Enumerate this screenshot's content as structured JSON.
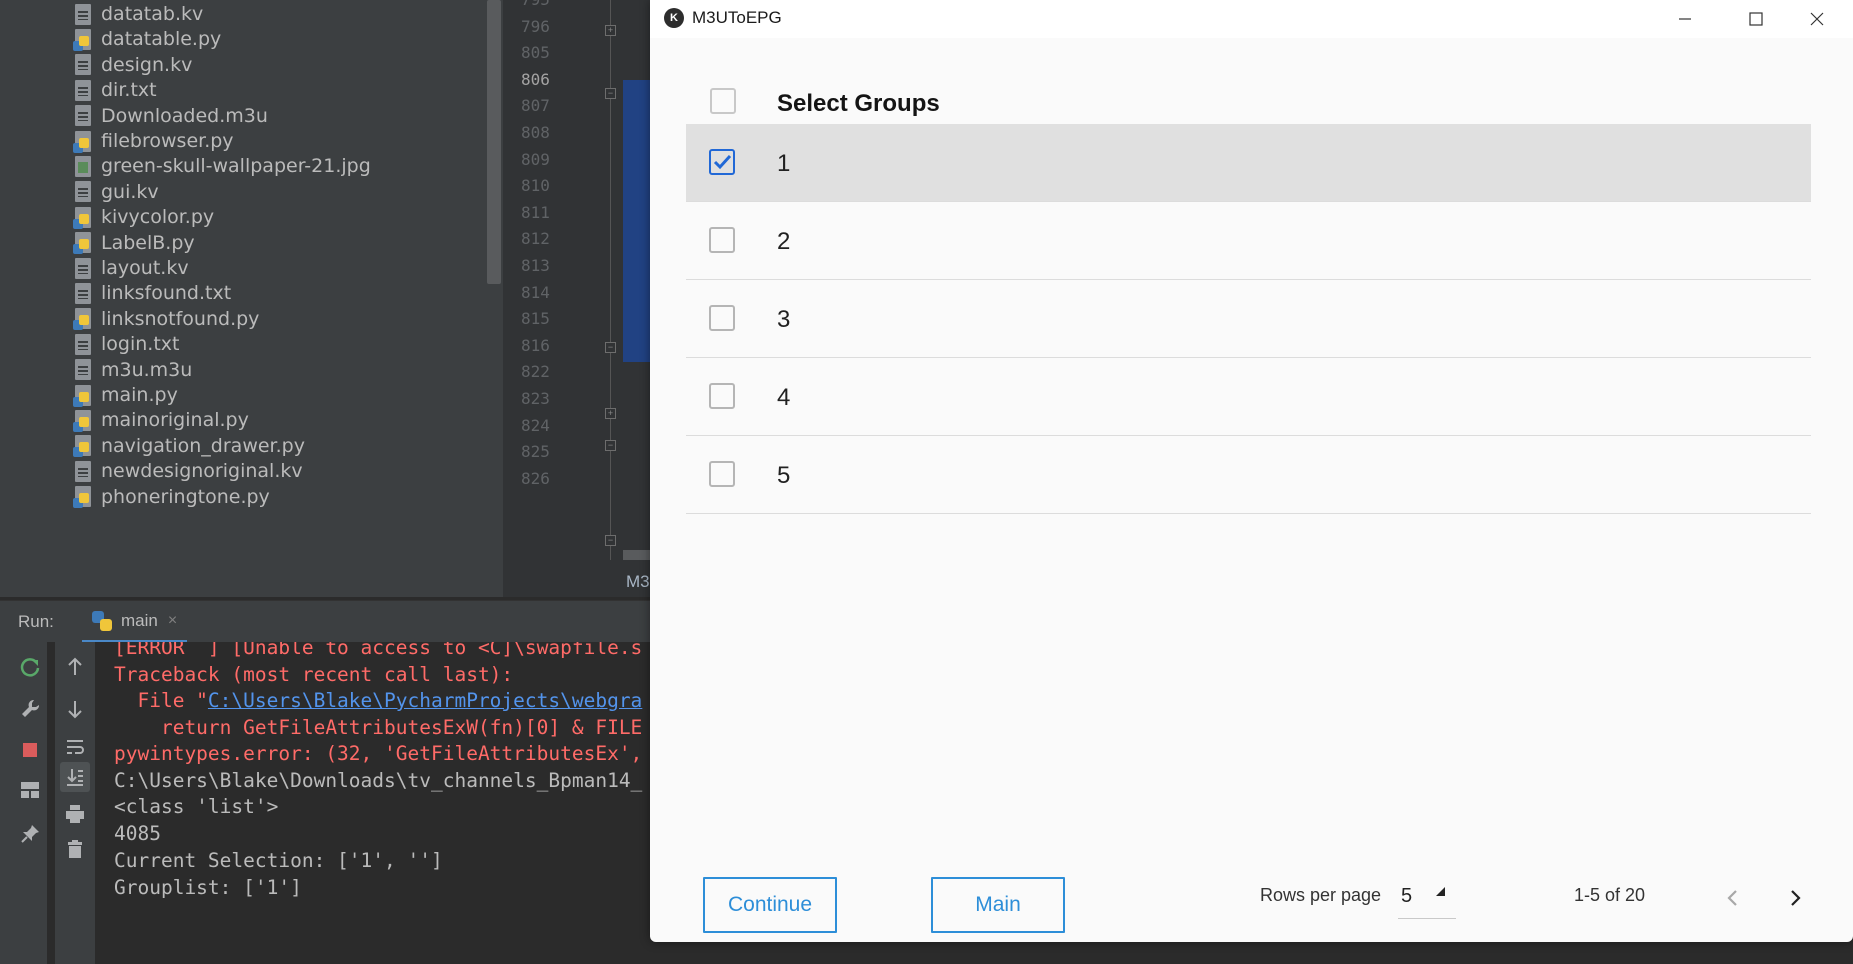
{
  "project_tree": {
    "files": [
      {
        "name": "datatab.kv",
        "type": "text"
      },
      {
        "name": "datatable.py",
        "type": "py"
      },
      {
        "name": "design.kv",
        "type": "text"
      },
      {
        "name": "dir.txt",
        "type": "text"
      },
      {
        "name": "Downloaded.m3u",
        "type": "text"
      },
      {
        "name": "filebrowser.py",
        "type": "py"
      },
      {
        "name": "green-skull-wallpaper-21.jpg",
        "type": "img"
      },
      {
        "name": "gui.kv",
        "type": "text"
      },
      {
        "name": "kivycolor.py",
        "type": "py"
      },
      {
        "name": "LabelB.py",
        "type": "py"
      },
      {
        "name": "layout.kv",
        "type": "text"
      },
      {
        "name": "linksfound.txt",
        "type": "text"
      },
      {
        "name": "linksnotfound.py",
        "type": "py"
      },
      {
        "name": "login.txt",
        "type": "text"
      },
      {
        "name": "m3u.m3u",
        "type": "text"
      },
      {
        "name": "main.py",
        "type": "py"
      },
      {
        "name": "mainoriginal.py",
        "type": "py"
      },
      {
        "name": "navigation_drawer.py",
        "type": "py"
      },
      {
        "name": "newdesignoriginal.kv",
        "type": "text"
      },
      {
        "name": "phoneringtone.py",
        "type": "py"
      }
    ]
  },
  "editor": {
    "line_numbers": [
      "795",
      "796",
      "805",
      "806",
      "807",
      "808",
      "809",
      "810",
      "811",
      "812",
      "813",
      "814",
      "815",
      "816",
      "822",
      "823",
      "824",
      "825",
      "826"
    ],
    "current_line": "806",
    "tab_fragment": "M3"
  },
  "run_panel": {
    "label": "Run:",
    "tab_name": "main",
    "tab_close": "×",
    "console": {
      "error_line_1": "[ERROR  ] [Unable to access to <C]\\swapfile.s",
      "traceback": "Traceback (most recent call last):",
      "file_prefix": "  File \"",
      "file_link": "C:\\Users\\Blake\\PycharmProjects\\webgra",
      "return_line": "    return GetFileAttributesExW(fn)[0] & FILE",
      "pywintypes_error": "pywintypes.error: (32, 'GetFileAttributesEx',",
      "downloads_path": "C:\\Users\\Blake\\Downloads\\tv_channels_Bpman14_",
      "class_list": "<class 'list'>",
      "count": "4085",
      "current_selection": "Current Selection: ['1', '']",
      "grouplist": "Grouplist: ['1']"
    }
  },
  "app": {
    "window_title": "M3UToEPG",
    "logo_glyph": "K",
    "controls": {
      "minimize": "—",
      "maximize": "☐",
      "close": "✕"
    },
    "table": {
      "header_title": "Select Groups",
      "rows": [
        {
          "label": "1",
          "checked": true
        },
        {
          "label": "2",
          "checked": false
        },
        {
          "label": "3",
          "checked": false
        },
        {
          "label": "4",
          "checked": false
        },
        {
          "label": "5",
          "checked": false
        }
      ]
    },
    "footer": {
      "continue_label": "Continue",
      "main_label": "Main",
      "rows_per_page_label": "Rows per page",
      "rows_per_page_value": "5",
      "pagination_info": "1-5 of 20"
    },
    "colors": {
      "accent": "#2d8ed8",
      "checkbox_checked": "#2168d6",
      "selected_row": "#e0e0e0"
    }
  }
}
